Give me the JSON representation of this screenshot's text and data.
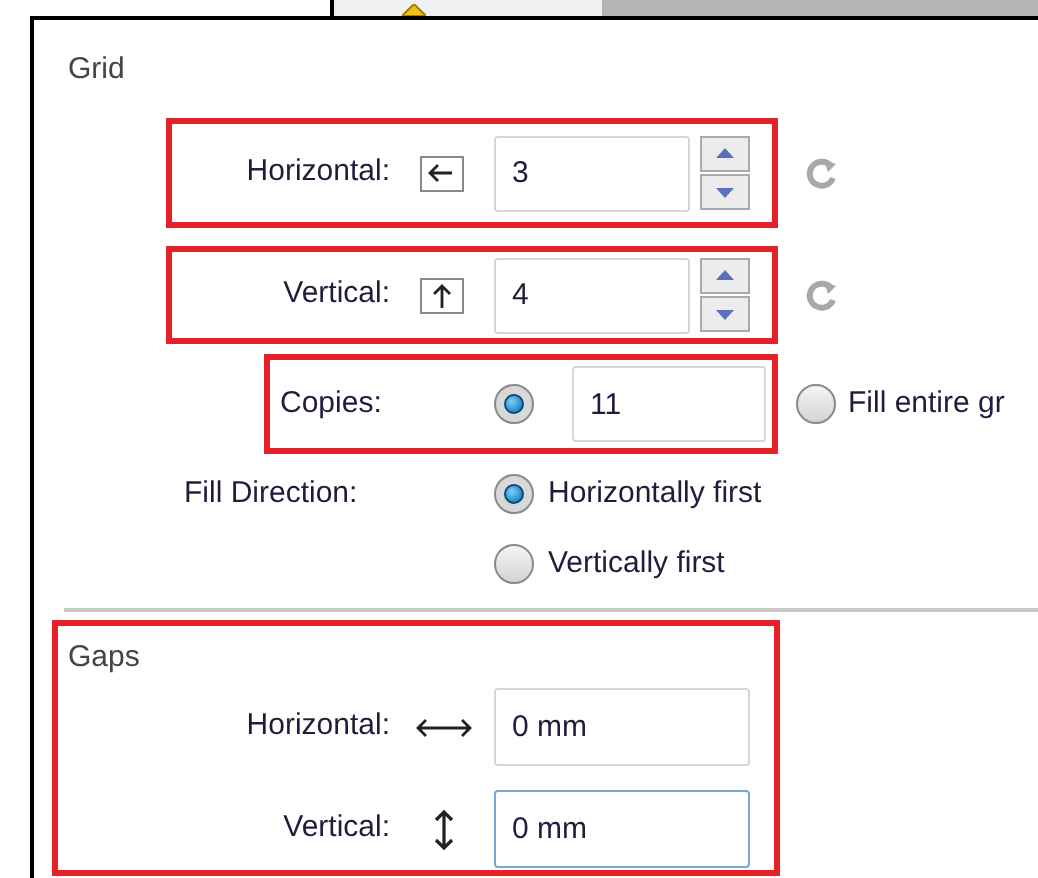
{
  "grid": {
    "title": "Grid",
    "rows": [
      {
        "kind": "horizontal",
        "label": "Horizontal:",
        "value": "3"
      },
      {
        "kind": "vertical",
        "label": "Vertical:",
        "value": "4"
      }
    ],
    "copies": {
      "label": "Copies:",
      "selected": true,
      "value": "11"
    },
    "fill_entire": {
      "label": "Fill entire gr",
      "selected": false
    },
    "fill_direction": {
      "label": "Fill Direction:",
      "options": [
        {
          "label": "Horizontally first",
          "selected": true
        },
        {
          "label": "Vertically first",
          "selected": false
        }
      ]
    }
  },
  "gaps": {
    "title": "Gaps",
    "rows": [
      {
        "kind": "horizontal",
        "label": "Horizontal:",
        "value": "0 mm",
        "focused": false
      },
      {
        "kind": "vertical",
        "label": "Vertical:",
        "value": "0 mm",
        "focused": true
      }
    ]
  }
}
